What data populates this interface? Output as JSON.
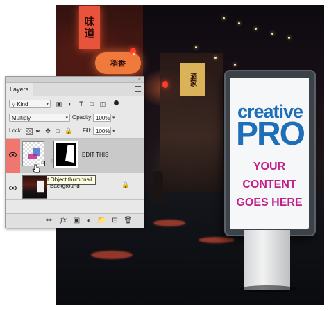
{
  "scene": {
    "signs": {
      "vertical": "味道",
      "round": "稻香",
      "yellow": "酒家"
    }
  },
  "billboard": {
    "brand_top": "creative",
    "brand_bottom": "PRO",
    "lines": [
      "YOUR",
      "CONTENT",
      "GOES HERE"
    ],
    "brand_color": "#1f6fb8",
    "accent_color": "#c21e8a"
  },
  "layers_panel": {
    "tab_label": "Layers",
    "filter_kind": "Kind",
    "blend_mode": "Multiply",
    "opacity_label": "Opacity:",
    "opacity_value": "100%",
    "lock_label": "Lock:",
    "fill_label": "Fill:",
    "fill_value": "100%",
    "layers": [
      {
        "name": "EDIT THIS",
        "selected": true,
        "type": "smart-object"
      },
      {
        "name": "Background",
        "selected": false,
        "locked": true
      }
    ],
    "tooltip": "Smart Object thumbnail",
    "selection_color": "#f07670"
  }
}
